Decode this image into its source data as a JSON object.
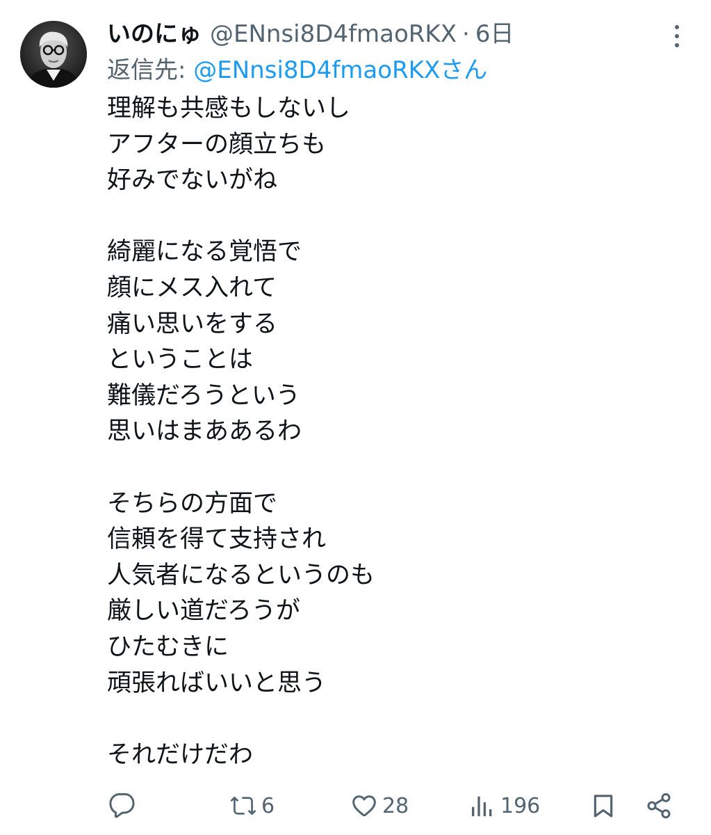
{
  "author": {
    "display_name": "いのにゅ",
    "handle": "@ENnsi8D4fmaoRKX",
    "separator": "·",
    "time": "6日"
  },
  "reply": {
    "prefix": "返信先: ",
    "mention": "@ENnsi8D4fmaoRKXさん"
  },
  "body_lines": [
    "理解も共感もしないし",
    "アフターの顔立ちも",
    "好みでないがね",
    "",
    "綺麗になる覚悟で",
    "顔にメス入れて",
    "痛い思いをする",
    "ということは",
    "難儀だろうという",
    "思いはまああるわ",
    "",
    "そちらの方面で",
    "信頼を得て支持され",
    "人気者になるというのも",
    "厳しい道だろうが",
    "ひたむきに",
    "頑張ればいいと思う",
    "",
    "それだけだわ"
  ],
  "actions": {
    "reply_count": "",
    "retweet_count": "6",
    "like_count": "28",
    "views_count": "196"
  },
  "icons": {
    "more": "more-vertical-icon",
    "reply": "reply-icon",
    "retweet": "retweet-icon",
    "like": "heart-icon",
    "views": "views-icon",
    "bookmark": "bookmark-icon",
    "share": "share-icon"
  },
  "colors": {
    "text": "#0f1419",
    "secondary": "#536471",
    "accent": "#1d9bf0"
  }
}
